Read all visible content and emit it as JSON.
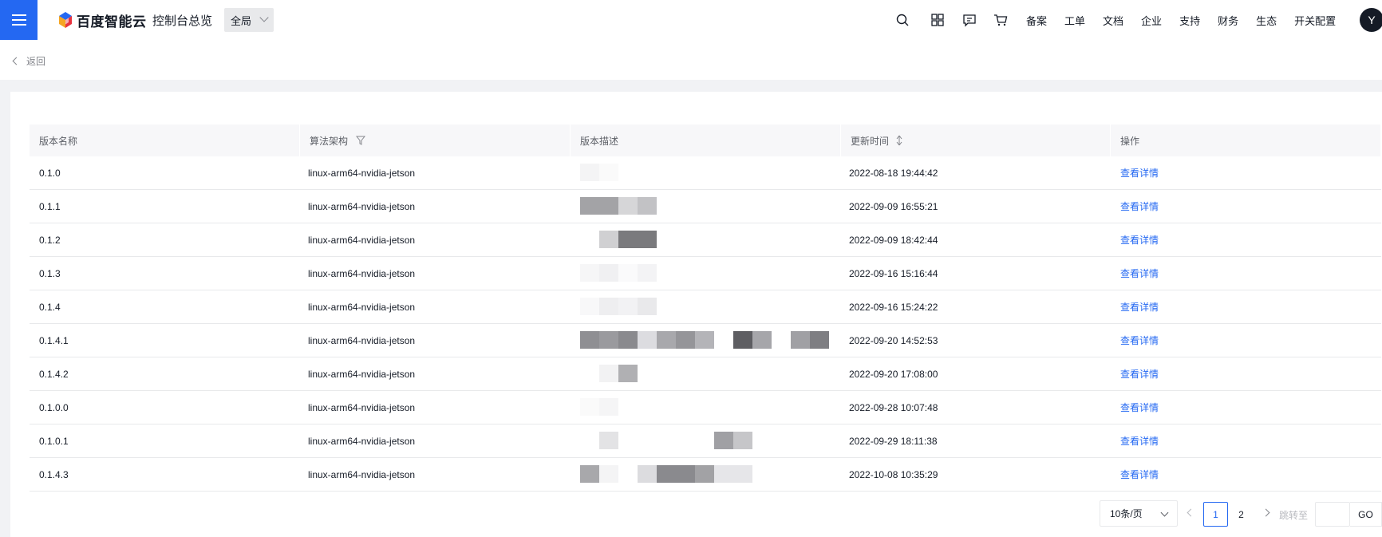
{
  "header": {
    "logo_text": "百度智能云",
    "console_link": "控制台总览",
    "region": "全局",
    "nav_items": [
      "备案",
      "工单",
      "文档",
      "企业",
      "支持",
      "财务",
      "生态",
      "开关配置"
    ],
    "avatar_letter": "Y"
  },
  "back_label": "返回",
  "table": {
    "columns": [
      "版本名称",
      "算法架构",
      "版本描述",
      "更新时间",
      "操作"
    ],
    "rows": [
      {
        "name": "0.1.0",
        "arch": "linux-arm64-nvidia-jetson",
        "time": "2022-08-18 19:44:42",
        "action": "查看详情"
      },
      {
        "name": "0.1.1",
        "arch": "linux-arm64-nvidia-jetson",
        "time": "2022-09-09 16:55:21",
        "action": "查看详情"
      },
      {
        "name": "0.1.2",
        "arch": "linux-arm64-nvidia-jetson",
        "time": "2022-09-09 18:42:44",
        "action": "查看详情"
      },
      {
        "name": "0.1.3",
        "arch": "linux-arm64-nvidia-jetson",
        "time": "2022-09-16 15:16:44",
        "action": "查看详情"
      },
      {
        "name": "0.1.4",
        "arch": "linux-arm64-nvidia-jetson",
        "time": "2022-09-16 15:24:22",
        "action": "查看详情"
      },
      {
        "name": "0.1.4.1",
        "arch": "linux-arm64-nvidia-jetson",
        "time": "2022-09-20 14:52:53",
        "action": "查看详情"
      },
      {
        "name": "0.1.4.2",
        "arch": "linux-arm64-nvidia-jetson",
        "time": "2022-09-20 17:08:00",
        "action": "查看详情"
      },
      {
        "name": "0.1.0.0",
        "arch": "linux-arm64-nvidia-jetson",
        "time": "2022-09-28 10:07:48",
        "action": "查看详情"
      },
      {
        "name": "0.1.0.1",
        "arch": "linux-arm64-nvidia-jetson",
        "time": "2022-09-29 18:11:38",
        "action": "查看详情"
      },
      {
        "name": "0.1.4.3",
        "arch": "linux-arm64-nvidia-jetson",
        "time": "2022-10-08 10:35:29",
        "action": "查看详情"
      }
    ]
  },
  "pagination": {
    "page_size": "10条/页",
    "pages": [
      "1",
      "2"
    ],
    "current": "1",
    "jump_label": "跳转至",
    "go_label": "GO"
  }
}
